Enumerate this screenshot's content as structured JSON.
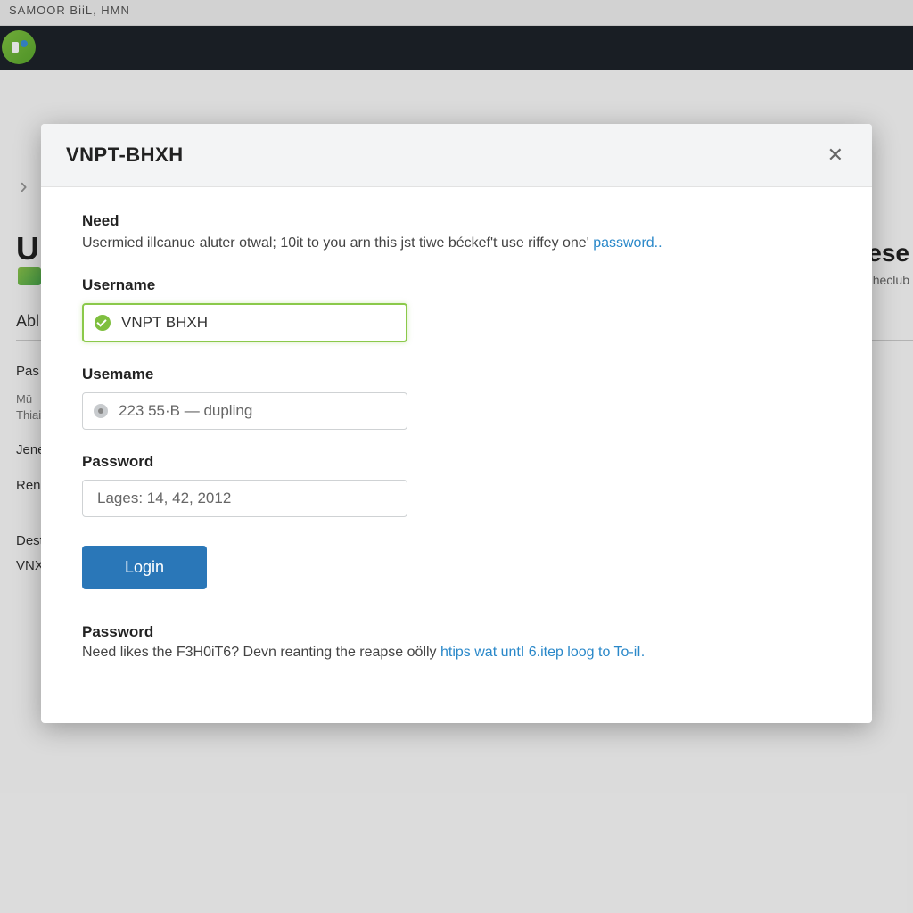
{
  "window": {
    "titlebar": "SAMOOR  BiiL,  HMN"
  },
  "background": {
    "chevron": "›",
    "title_left": "U",
    "title_right": "ese",
    "sub_right": "heclub",
    "tab": "Abl",
    "rows": {
      "r1": "Pas",
      "r1b": "Mü",
      "r1c": "Thiai",
      "r2": "Jene",
      "r3": "Rene",
      "r4": "Dest",
      "r5": "VNX"
    }
  },
  "modal": {
    "title": "VNPT-BHXH",
    "intro_heading": "Need",
    "intro_text": "Usermied illcanue aluter otwal; 10it to you arn this jst tiwe béckef't use riffey one' ",
    "intro_link": "password..",
    "fields": {
      "f1_label": "Username",
      "f1_value": "VNPT BHXH",
      "f2_label": "Usemame",
      "f2_value": "223 55·B — dupling",
      "f3_label": "Password",
      "f3_value": "Lages: 14, 42, 2012"
    },
    "login_button": "Login",
    "footer_heading": "Password",
    "footer_text": "Need likes the F3H0iT6? Devn reanting the reapse oölly ",
    "footer_link": "htips wat untI 6.itep loog to To-iI."
  }
}
